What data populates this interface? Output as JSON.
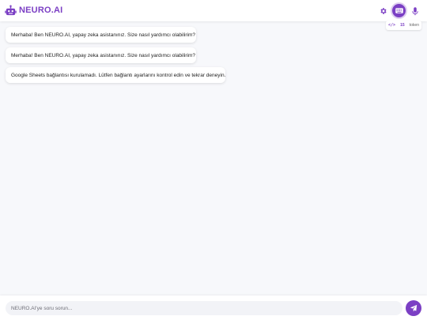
{
  "header": {
    "brand": "NEURO.AI",
    "icons": {
      "logo": "robot-icon",
      "settings": "gear-icon",
      "keyboard": "keyboard-icon",
      "voice": "microphone-icon"
    },
    "token_counter": {
      "icon": "</>",
      "count": "15",
      "unit": "token"
    }
  },
  "messages": [
    {
      "role": "assistant",
      "text": "Merhaba! Ben NEURO.AI, yapay zeka asistanınız. Size nasıl yardımcı olabilirim?"
    },
    {
      "role": "assistant",
      "text": "Merhaba! Ben NEURO.AI, yapay zeka asistanınız. Size nasıl yardımcı olabilirim?"
    },
    {
      "role": "assistant",
      "text": "Google Sheets bağlantısı kurulamadı. Lütfen bağlantı ayarlarını kontrol edin ve tekrar deneyin."
    }
  ],
  "composer": {
    "placeholder": "NEURO.AI'ye soru sorun...",
    "value": "",
    "send_icon": "send-icon"
  },
  "colors": {
    "accent": "#7b3fc4",
    "background": "#f7f8fb"
  }
}
